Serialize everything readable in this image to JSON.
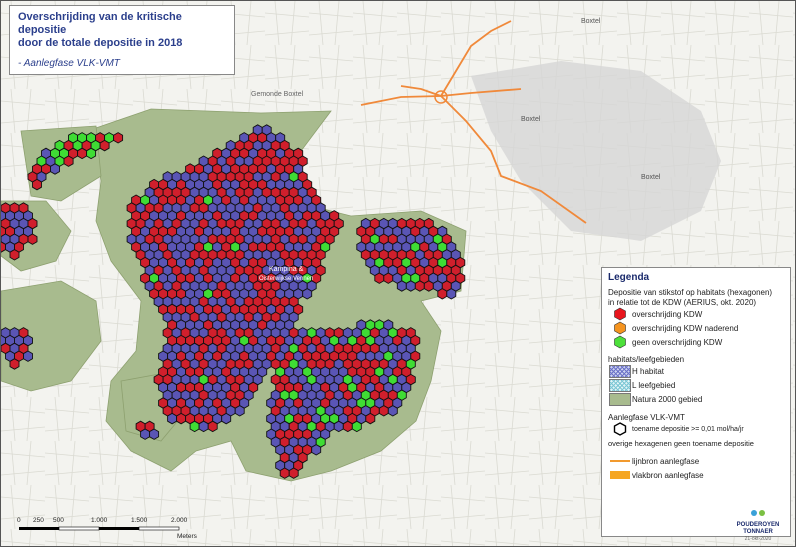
{
  "title": {
    "line1": "Overschrijding van de kritische depositie",
    "line2": "door de totale depositie in 2018",
    "subtitle": "- Aanlegfase VLK-VMT"
  },
  "map_labels": {
    "town1": "Boxtel",
    "town2": "Boxtel",
    "town3": "Boxtel",
    "town4": "Gemonde Boxtel",
    "area_name": "Kampina &",
    "area_name2": "Oisterwijkse Vennen"
  },
  "legend": {
    "title": "Legenda",
    "section1": "Depositie van stikstof op habitats (hexagonen)",
    "section1b": "in relatie tot de KDW (AERIUS, okt. 2020)",
    "items": [
      {
        "label": "overschrijding KDW",
        "color": "#e8151d"
      },
      {
        "label": "overschrijding KDW naderend",
        "color": "#f5941f"
      },
      {
        "label": "geen overschrijding KDW",
        "color": "#4de03a"
      }
    ],
    "section2": "habitats/leefgebieden",
    "habitat_items": [
      {
        "label": "H habitat"
      },
      {
        "label": "L leefgebied"
      },
      {
        "label": "Natura 2000 gebied"
      }
    ],
    "section3": "Aanlegfase VLK-VMT",
    "hex_item": "toename depositie >= 0,01 mol/ha/jr",
    "note": "overige hexagenen geen toename depositie",
    "line_items": [
      {
        "label": "lijnbron aanlegfase"
      },
      {
        "label": "vlakbron aanlegfase"
      }
    ]
  },
  "scale": {
    "ticks": [
      "0",
      "250",
      "500",
      "1.000",
      "1.500",
      "2.000"
    ],
    "unit": "Meters"
  },
  "logo": {
    "line1": "POUDEROYEN",
    "line2": "TONNAER",
    "date": "21-okt-2020"
  },
  "colors": {
    "natura": "#a8bb8e",
    "exceed": "#d21f2a",
    "habitat_blue": "#5b55b8",
    "ok": "#41d83a",
    "route": "#f0893a"
  }
}
